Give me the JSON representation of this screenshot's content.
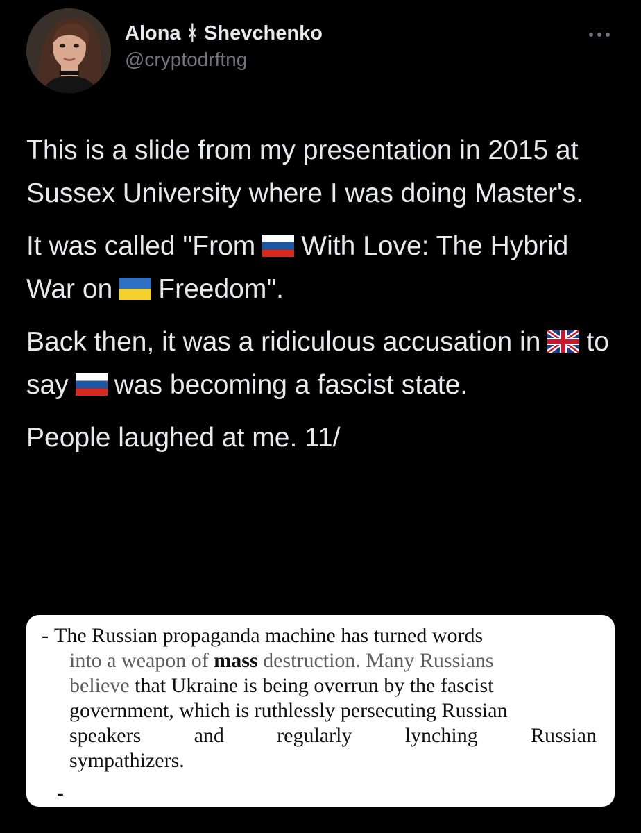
{
  "author": {
    "name_first": "Alona",
    "name_symbol": "ᚼ",
    "name_last": "Shevchenko",
    "handle": "@cryptodrftng"
  },
  "icons": {
    "more": "more-options-icon",
    "flag_russia": "russia-flag-icon",
    "flag_ukraine": "ukraine-flag-icon",
    "flag_uk": "uk-flag-icon"
  },
  "tweet": {
    "p1": "This is a slide from my presentation in 2015 at Sussex University where I was doing Master's.",
    "p2_a": "It was called \"From",
    "p2_b": "With Love: The Hybrid War on",
    "p2_c": "Freedom\".",
    "p3_a": "Back then, it was a ridiculous accusation in",
    "p3_b": "to say",
    "p3_c": "was becoming a fascist state.",
    "p4": "People laughed at me. 11/"
  },
  "slide": {
    "bullet": "-",
    "s1": "The Russian propaganda machine has turned words",
    "s2_a": "into a weapon of",
    "s2_bold": "mass",
    "s2_b": "destruction. Many Russians",
    "s3_gray": "believe",
    "s3_rest": "that Ukraine is being overrun by the fascist",
    "s4": "government, which is ruthlessly persecuting Russian",
    "s5_words": [
      "speakers",
      "and",
      "regularly",
      "lynching",
      "Russian"
    ],
    "s6": "sympathizers.",
    "trailing_dash": "-"
  },
  "colors": {
    "background": "#000000",
    "text_primary": "#e7e9ea",
    "text_secondary": "#71767b",
    "card_bg": "#ffffff"
  }
}
